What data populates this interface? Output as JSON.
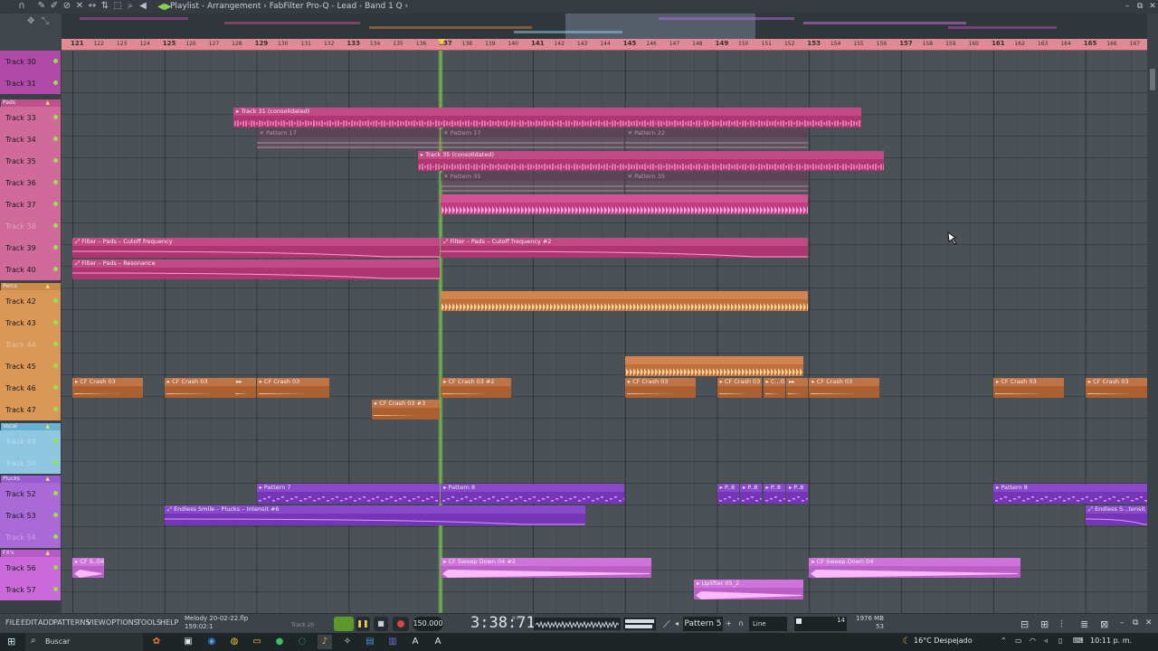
{
  "window": {
    "title": "Playlist - Arrangement",
    "breadcrumb_sep": "›",
    "plugin_path": "FabFilter Pro-Q - Lead - Band 1 Q",
    "trail": "›"
  },
  "ruler": {
    "bars": [
      "121",
      "122",
      "123",
      "124",
      "125",
      "126",
      "127",
      "128",
      "129",
      "130",
      "131",
      "132",
      "133",
      "134",
      "135",
      "136",
      "137",
      "138",
      "139",
      "140",
      "141",
      "142",
      "143",
      "144",
      "145",
      "146",
      "147",
      "148",
      "149",
      "150",
      "151",
      "152",
      "153",
      "154",
      "155",
      "156",
      "157",
      "158",
      "159",
      "160",
      "161",
      "162",
      "163",
      "164",
      "165",
      "166",
      "167"
    ],
    "major_bars": [
      "121",
      "125",
      "129",
      "133",
      "137",
      "141",
      "145",
      "149",
      "153",
      "157",
      "161",
      "165"
    ]
  },
  "groups": [
    {
      "label": "Pads",
      "top_track": 33
    },
    {
      "label": "Percs",
      "top_track": 42
    },
    {
      "label": "Vocal",
      "top_track": 49
    },
    {
      "label": "Plucks",
      "top_track": 52
    },
    {
      "label": "FX's",
      "top_track": 56
    }
  ],
  "tracks": [
    {
      "name": "Track 30",
      "color": "#b04aa8",
      "muted": false
    },
    {
      "name": "Track 31",
      "color": "#b04aa8",
      "muted": false
    },
    {
      "name": "Track 33",
      "color": "#d06a9a",
      "muted": false
    },
    {
      "name": "Track 34",
      "color": "#d06a9a",
      "muted": false
    },
    {
      "name": "Track 35",
      "color": "#d06a9a",
      "muted": false
    },
    {
      "name": "Track 36",
      "color": "#d06a9a",
      "muted": false
    },
    {
      "name": "Track 37",
      "color": "#d06a9a",
      "muted": false
    },
    {
      "name": "Track 38",
      "color": "#d06a9a",
      "muted": true
    },
    {
      "name": "Track 39",
      "color": "#d06a9a",
      "muted": false
    },
    {
      "name": "Track 40",
      "color": "#d06a9a",
      "muted": false
    },
    {
      "name": "Track 42",
      "color": "#d99858",
      "muted": false
    },
    {
      "name": "Track 43",
      "color": "#d99858",
      "muted": false
    },
    {
      "name": "Track 44",
      "color": "#d99858",
      "muted": true
    },
    {
      "name": "Track 45",
      "color": "#d99858",
      "muted": false
    },
    {
      "name": "Track 46",
      "color": "#d99858",
      "muted": false
    },
    {
      "name": "Track 47",
      "color": "#d99858",
      "muted": false
    },
    {
      "name": "Track 49",
      "color": "#8fc6e0",
      "muted": true
    },
    {
      "name": "Track 50",
      "color": "#8fc6e0",
      "muted": true
    },
    {
      "name": "Track 52",
      "color": "#a96ad8",
      "muted": false
    },
    {
      "name": "Track 53",
      "color": "#a96ad8",
      "muted": false
    },
    {
      "name": "Track 54",
      "color": "#a96ad8",
      "muted": true
    },
    {
      "name": "Track 56",
      "color": "#c96ad8",
      "muted": false
    },
    {
      "name": "Track 57",
      "color": "#c96ad8",
      "muted": false
    }
  ],
  "clips": [
    {
      "title": "▸ Track 31 (consolidated)",
      "lane": 2,
      "start": 128.0,
      "end": 155.3,
      "color": "#b8407a",
      "kind": "audio"
    },
    {
      "title": "✕ Pattern 17",
      "lane": 3,
      "start": 129.0,
      "end": 137.0,
      "color": "#7a4a62",
      "kind": "ghost"
    },
    {
      "title": "✕ Pattern 17",
      "lane": 3,
      "start": 137.0,
      "end": 145.0,
      "color": "#7a4a62",
      "kind": "ghost"
    },
    {
      "title": "✕ Pattern 22",
      "lane": 3,
      "start": 145.0,
      "end": 153.0,
      "color": "#7a4a62",
      "kind": "ghost"
    },
    {
      "title": "▸ Track 35 (consolidated)",
      "lane": 4,
      "start": 136.0,
      "end": 156.3,
      "color": "#b8407a",
      "kind": "audio"
    },
    {
      "title": "✕ Pattern 31",
      "lane": 5,
      "start": 137.0,
      "end": 145.0,
      "color": "#7a4a62",
      "kind": "ghost"
    },
    {
      "title": "✕ Pattern 35",
      "lane": 5,
      "start": 145.0,
      "end": 153.0,
      "color": "#7a4a62",
      "kind": "ghost"
    },
    {
      "title": "",
      "lane": 6,
      "start": 137.0,
      "end": 153.0,
      "color": "#c8488a",
      "kind": "dense"
    },
    {
      "title": "⤢ Filter – Pads – Cutoff frequency",
      "lane": 8,
      "start": 121.0,
      "end": 137.0,
      "color": "#b8407a",
      "kind": "auto"
    },
    {
      "title": "⤢ Filter – Pads – Cutoff frequency #2",
      "lane": 8,
      "start": 137.0,
      "end": 153.0,
      "color": "#b8407a",
      "kind": "auto"
    },
    {
      "title": "⤢ Filter – Pads – Resonance",
      "lane": 9,
      "start": 121.0,
      "end": 137.0,
      "color": "#b8407a",
      "kind": "auto"
    },
    {
      "title": "",
      "lane": 10,
      "start": 137.0,
      "end": 153.0,
      "color": "#c97a44",
      "kind": "dense"
    },
    {
      "title": "",
      "lane": 13,
      "start": 145.0,
      "end": 152.8,
      "color": "#c97a44",
      "kind": "dense"
    },
    {
      "title": "▸ CF Crash 03",
      "lane": 14,
      "start": 121.0,
      "end": 124.1,
      "color": "#b56a3c",
      "kind": "crash"
    },
    {
      "title": "▸ CF Crash 03",
      "lane": 14,
      "start": 125.0,
      "end": 128.1,
      "color": "#b56a3c",
      "kind": "crash"
    },
    {
      "title": "▸▸",
      "lane": 14,
      "start": 128.0,
      "end": 129.0,
      "color": "#b56a3c",
      "kind": "crash"
    },
    {
      "title": "▸ CF Crash 03",
      "lane": 14,
      "start": 129.0,
      "end": 132.2,
      "color": "#b56a3c",
      "kind": "crash"
    },
    {
      "title": "▸ CF Crash 03 #2",
      "lane": 14,
      "start": 137.0,
      "end": 140.1,
      "color": "#b56a3c",
      "kind": "crash"
    },
    {
      "title": "▸ CF Crash 03",
      "lane": 14,
      "start": 145.0,
      "end": 148.1,
      "color": "#b56a3c",
      "kind": "crash"
    },
    {
      "title": "▸ CF Crash 03",
      "lane": 14,
      "start": 149.0,
      "end": 151.0,
      "color": "#b56a3c",
      "kind": "crash"
    },
    {
      "title": "▸ C…03",
      "lane": 14,
      "start": 151.0,
      "end": 152.0,
      "color": "#b56a3c",
      "kind": "crash"
    },
    {
      "title": "▸▸",
      "lane": 14,
      "start": 152.0,
      "end": 153.0,
      "color": "#b56a3c",
      "kind": "crash"
    },
    {
      "title": "▸ CF Crash 03",
      "lane": 14,
      "start": 153.0,
      "end": 156.1,
      "color": "#b56a3c",
      "kind": "crash"
    },
    {
      "title": "▸ CF Crash 03",
      "lane": 14,
      "start": 161.0,
      "end": 164.1,
      "color": "#b56a3c",
      "kind": "crash"
    },
    {
      "title": "▸ CF Crash 03",
      "lane": 14,
      "start": 165.0,
      "end": 168.0,
      "color": "#b56a3c",
      "kind": "crash"
    },
    {
      "title": "▸ CF Crash 03 #3",
      "lane": 15,
      "start": 134.0,
      "end": 137.0,
      "color": "#b56a3c",
      "kind": "crash"
    },
    {
      "title": "▸ Pattern 7",
      "lane": 18,
      "start": 129.0,
      "end": 137.0,
      "color": "#7e3fc0",
      "kind": "pattern"
    },
    {
      "title": "▸ Pattern 8",
      "lane": 18,
      "start": 137.0,
      "end": 145.0,
      "color": "#7e3fc0",
      "kind": "pattern"
    },
    {
      "title": "▸ P..8",
      "lane": 18,
      "start": 149.0,
      "end": 150.0,
      "color": "#7e3fc0",
      "kind": "pattern"
    },
    {
      "title": "▸ P..8",
      "lane": 18,
      "start": 150.0,
      "end": 151.0,
      "color": "#7e3fc0",
      "kind": "pattern"
    },
    {
      "title": "▸ P..8",
      "lane": 18,
      "start": 151.0,
      "end": 152.0,
      "color": "#7e3fc0",
      "kind": "pattern"
    },
    {
      "title": "▸ P..8",
      "lane": 18,
      "start": 152.0,
      "end": 153.0,
      "color": "#7e3fc0",
      "kind": "pattern"
    },
    {
      "title": "▸ Pattern 8",
      "lane": 18,
      "start": 161.0,
      "end": 168.0,
      "color": "#7e3fc0",
      "kind": "pattern"
    },
    {
      "title": "⤢ Endless Smile – Plucks – Intensit #6",
      "lane": 19,
      "start": 125.0,
      "end": 143.3,
      "color": "#7e3fc0",
      "kind": "auto"
    },
    {
      "title": "⤢ Endless S...tensit #2",
      "lane": 19,
      "start": 165.0,
      "end": 168.0,
      "color": "#7e3fc0",
      "kind": "auto"
    },
    {
      "title": "▸ CF S..04",
      "lane": 21,
      "start": 121.0,
      "end": 122.4,
      "color": "#c46ad0",
      "kind": "sweep"
    },
    {
      "title": "▸ CF Sweep Down 04 #2",
      "lane": 21,
      "start": 137.0,
      "end": 146.2,
      "color": "#c46ad0",
      "kind": "sweep"
    },
    {
      "title": "▸ CF Sweep Down 04",
      "lane": 21,
      "start": 153.0,
      "end": 162.2,
      "color": "#c46ad0",
      "kind": "sweep"
    },
    {
      "title": "▸ Uplifter 05_2",
      "lane": 22,
      "start": 148.0,
      "end": 152.8,
      "color": "#c46ad0",
      "kind": "sweep"
    }
  ],
  "playhead_bar": 137.0,
  "bottom_bar": {
    "menus": [
      "FILE",
      "EDIT",
      "ADD",
      "PATTERNS",
      "VIEW",
      "OPTIONS",
      "TOOLS",
      "HELP"
    ],
    "project_name": "Melody 20-02-22.flp",
    "position": "159:02:1",
    "track_hint": "Track 20",
    "tempo": "150.000",
    "time": "3:38:71",
    "time_unit": "M:S:CS",
    "pattern": "Pattern 5",
    "snap": "Line",
    "cpu_value": "14",
    "memory": "1976 MB",
    "polyphony": "53"
  },
  "taskbar": {
    "search_placeholder": "Buscar",
    "weather": "16°C  Despejado",
    "clock": "10:11 p. m."
  },
  "colors": {
    "accent_green": "#7cc447",
    "grid_bg": "#4b5257",
    "ruler": "#e08a96"
  }
}
